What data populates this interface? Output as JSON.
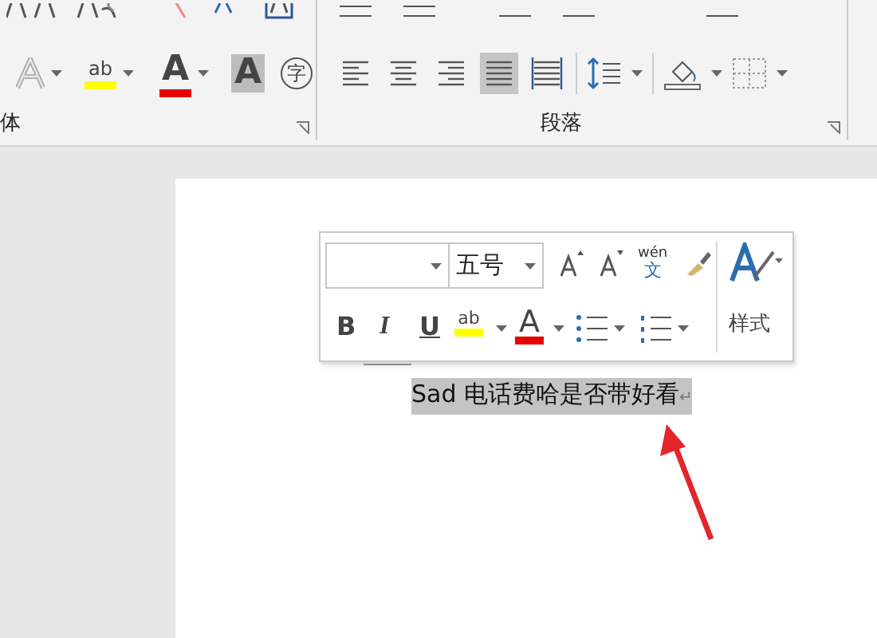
{
  "ribbon": {
    "font_group": {
      "highlight": "ab",
      "font_color": "A",
      "char_shading": "A",
      "enclose_char": "字",
      "label": "体"
    },
    "paragraph_group": {
      "alignment": [
        {
          "kind": "left",
          "selected": false
        },
        {
          "kind": "center",
          "selected": false
        },
        {
          "kind": "right",
          "selected": false
        },
        {
          "kind": "justify",
          "selected": true
        },
        {
          "kind": "distributed",
          "selected": false
        }
      ],
      "label": "段落"
    }
  },
  "mini_toolbar": {
    "font_size": "五号",
    "phonetic_top": "wén",
    "phonetic_bottom": "文",
    "bold": "B",
    "italic": "I",
    "underline": "U",
    "highlight": "ab",
    "font_color": "A",
    "styles": "样式"
  },
  "document": {
    "text": "Sad 电话费哈是否带好看",
    "paragraph_mark": "↵",
    "selected": true
  }
}
